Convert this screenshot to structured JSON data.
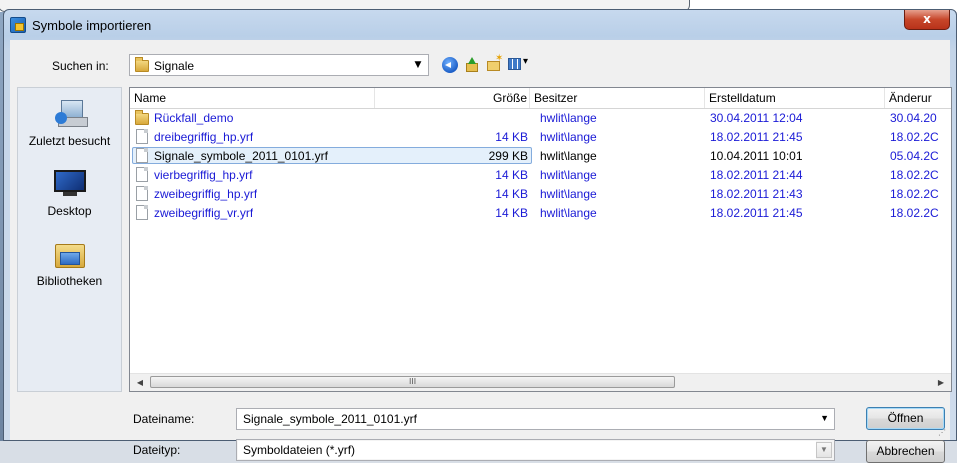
{
  "dialog": {
    "title": "Symbole importieren",
    "close_label": "x"
  },
  "lookin": {
    "label": "Suchen in:",
    "value": "Signale"
  },
  "places": [
    {
      "label": "Zuletzt besucht",
      "icon": "recent-places-icon"
    },
    {
      "label": "Desktop",
      "icon": "desktop-icon"
    },
    {
      "label": "Bibliotheken",
      "icon": "libraries-icon"
    }
  ],
  "columns": {
    "name": "Name",
    "size": "Größe",
    "owner": "Besitzer",
    "created": "Erstelldatum",
    "modified": "Änderur"
  },
  "files": [
    {
      "name": "Rückfall_demo",
      "type": "folder",
      "size": "",
      "owner": "hwlit\\lange",
      "created": "30.04.2011 12:04",
      "modified": "30.04.20"
    },
    {
      "name": "dreibegriffig_hp.yrf",
      "type": "file",
      "size": "14 KB",
      "owner": "hwlit\\lange",
      "created": "18.02.2011 21:45",
      "modified": "18.02.2C"
    },
    {
      "name": "Signale_symbole_2011_0101.yrf",
      "type": "file",
      "size": "299 KB",
      "owner": "hwlit\\lange",
      "created": "10.04.2011 10:01",
      "modified": "05.04.2C",
      "selected": true
    },
    {
      "name": "vierbegriffig_hp.yrf",
      "type": "file",
      "size": "14 KB",
      "owner": "hwlit\\lange",
      "created": "18.02.2011 21:44",
      "modified": "18.02.2C"
    },
    {
      "name": "zweibegriffig_hp.yrf",
      "type": "file",
      "size": "14 KB",
      "owner": "hwlit\\lange",
      "created": "18.02.2011 21:43",
      "modified": "18.02.2C"
    },
    {
      "name": "zweibegriffig_vr.yrf",
      "type": "file",
      "size": "14 KB",
      "owner": "hwlit\\lange",
      "created": "18.02.2011 21:45",
      "modified": "18.02.2C"
    }
  ],
  "scrollbar": {
    "grip": "III"
  },
  "filename": {
    "label": "Dateiname:",
    "value": "Signale_symbole_2011_0101.yrf"
  },
  "filetype": {
    "label": "Dateityp:",
    "value": "Symboldateien (*.yrf)"
  },
  "buttons": {
    "open": "Öffnen",
    "cancel": "Abbrechen"
  },
  "colors": {
    "link_text": "#1a1ad6",
    "selection_bg": "#e4f0fb",
    "close_button": "#c7462a"
  }
}
